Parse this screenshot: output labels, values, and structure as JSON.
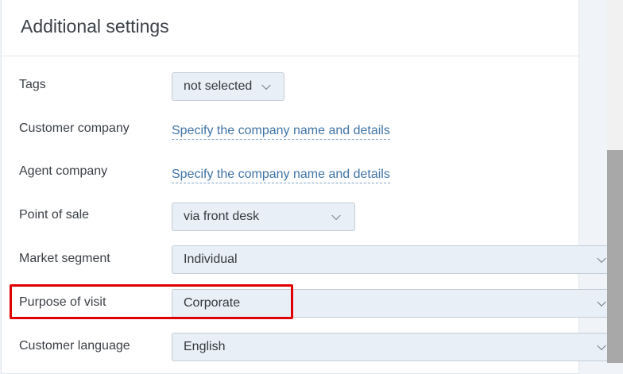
{
  "section": {
    "title": "Additional settings"
  },
  "fields": {
    "tags": {
      "label": "Tags",
      "value": "not selected"
    },
    "customer_company": {
      "label": "Customer company",
      "link": "Specify the company name and details"
    },
    "agent_company": {
      "label": "Agent company",
      "link": "Specify the company name and details"
    },
    "point_of_sale": {
      "label": "Point of sale",
      "value": "via front desk"
    },
    "market_segment": {
      "label": "Market segment",
      "value": "Individual"
    },
    "purpose_of_visit": {
      "label": "Purpose of visit",
      "value": "Corporate"
    },
    "customer_language": {
      "label": "Customer language",
      "value": "English"
    }
  },
  "colors": {
    "link": "#3f73a6",
    "select_bg": "#e9eff6",
    "highlight": "#e00000"
  }
}
